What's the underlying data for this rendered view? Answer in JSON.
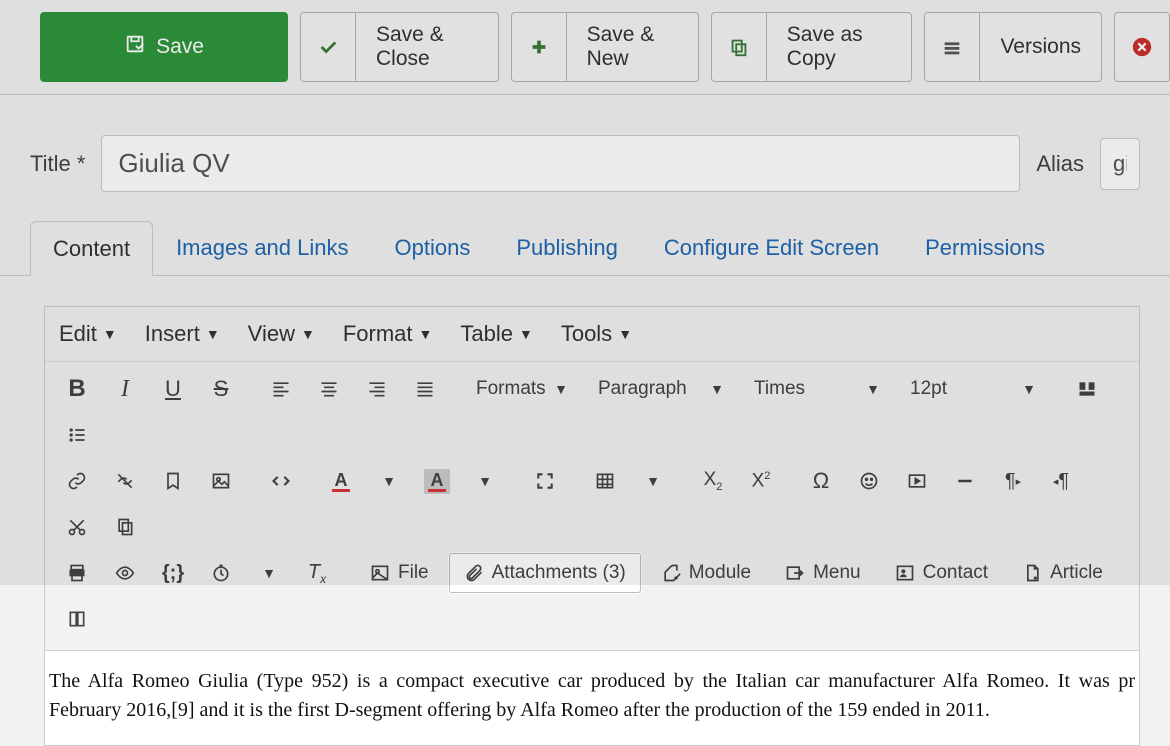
{
  "toolbar": {
    "save": "Save",
    "saveClose": "Save & Close",
    "saveNew": "Save & New",
    "saveCopy": "Save as Copy",
    "versions": "Versions"
  },
  "title": {
    "label": "Title *",
    "value": "Giulia QV",
    "aliasLabel": "Alias",
    "aliasValue": "giu"
  },
  "tabs": [
    {
      "label": "Content",
      "active": true
    },
    {
      "label": "Images and Links"
    },
    {
      "label": "Options"
    },
    {
      "label": "Publishing"
    },
    {
      "label": "Configure Edit Screen"
    },
    {
      "label": "Permissions"
    }
  ],
  "menubar": [
    "Edit",
    "Insert",
    "View",
    "Format",
    "Table",
    "Tools"
  ],
  "formatsDropdown": "Formats",
  "blockDropdown": "Paragraph",
  "fontDropdown": "Times",
  "sizeDropdown": "12pt",
  "buttons": {
    "file": "File",
    "attachments": "Attachments (3)",
    "module": "Module",
    "menu": "Menu",
    "contact": "Contact",
    "article": "Article"
  },
  "content": "The Alfa Romeo Giulia (Type 952) is a compact executive car produced by the Italian car manufacturer Alfa Romeo. It was pr February 2016,[9] and it is the first D-segment offering by Alfa Romeo after the production of the 159 ended in 2011."
}
